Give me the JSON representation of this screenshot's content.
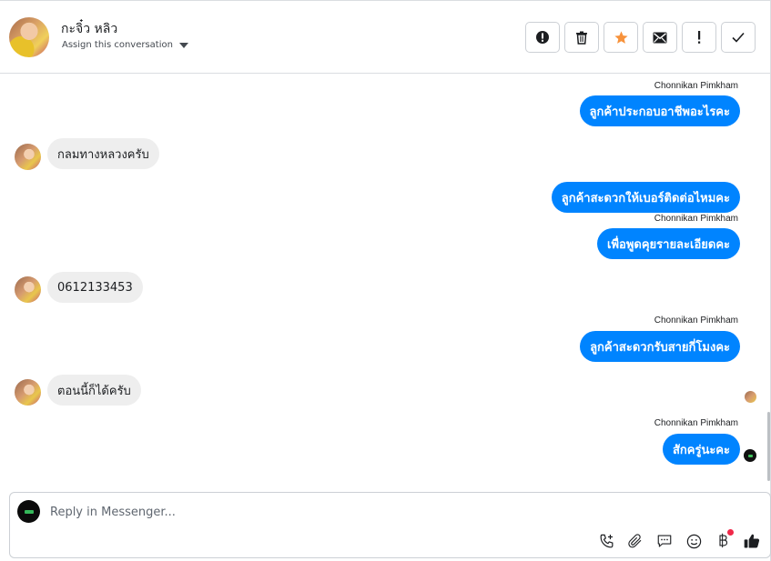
{
  "header": {
    "contact_name": "กะจิ๋ว หลิว",
    "assign_label": "Assign this conversation",
    "actions": [
      {
        "name": "spam-button",
        "icon": "exclamation-circle-icon"
      },
      {
        "name": "delete-button",
        "icon": "trash-icon"
      },
      {
        "name": "star-button",
        "icon": "star-icon",
        "color": "#f7923b"
      },
      {
        "name": "mark-unread-button",
        "icon": "envelope-icon"
      },
      {
        "name": "flag-button",
        "icon": "exclamation-icon"
      },
      {
        "name": "mark-done-button",
        "icon": "checkmark-icon"
      }
    ]
  },
  "messages": {
    "sender_name": "Chonnikan Pimkham",
    "m1": "ลูกค้าประกอบอาชีพอะไรคะ",
    "m2": "กลมทางหลวงครับ",
    "m3": "ลูกค้าสะดวกให้เบอร์ติดต่อไหมคะ",
    "m4": "เพื่อพูดคุยรายละเอียดคะ",
    "m5": "0612133453",
    "m6": "ลูกค้าสะดวกรับสายกี่โมงคะ",
    "m7": "ตอนนี้ก็ได้ครับ",
    "m8": "สักครู่นะคะ"
  },
  "composer": {
    "placeholder": "Reply in Messenger...",
    "tools": [
      "phone-add-icon",
      "paperclip-icon",
      "saved-reply-icon",
      "emoji-icon",
      "baht-payment-icon",
      "thumbs-up-icon"
    ]
  },
  "colors": {
    "outgoing_bubble": "#0084ff",
    "incoming_bubble": "#eeeeee",
    "star": "#f7923b",
    "notification": "#f02849"
  }
}
